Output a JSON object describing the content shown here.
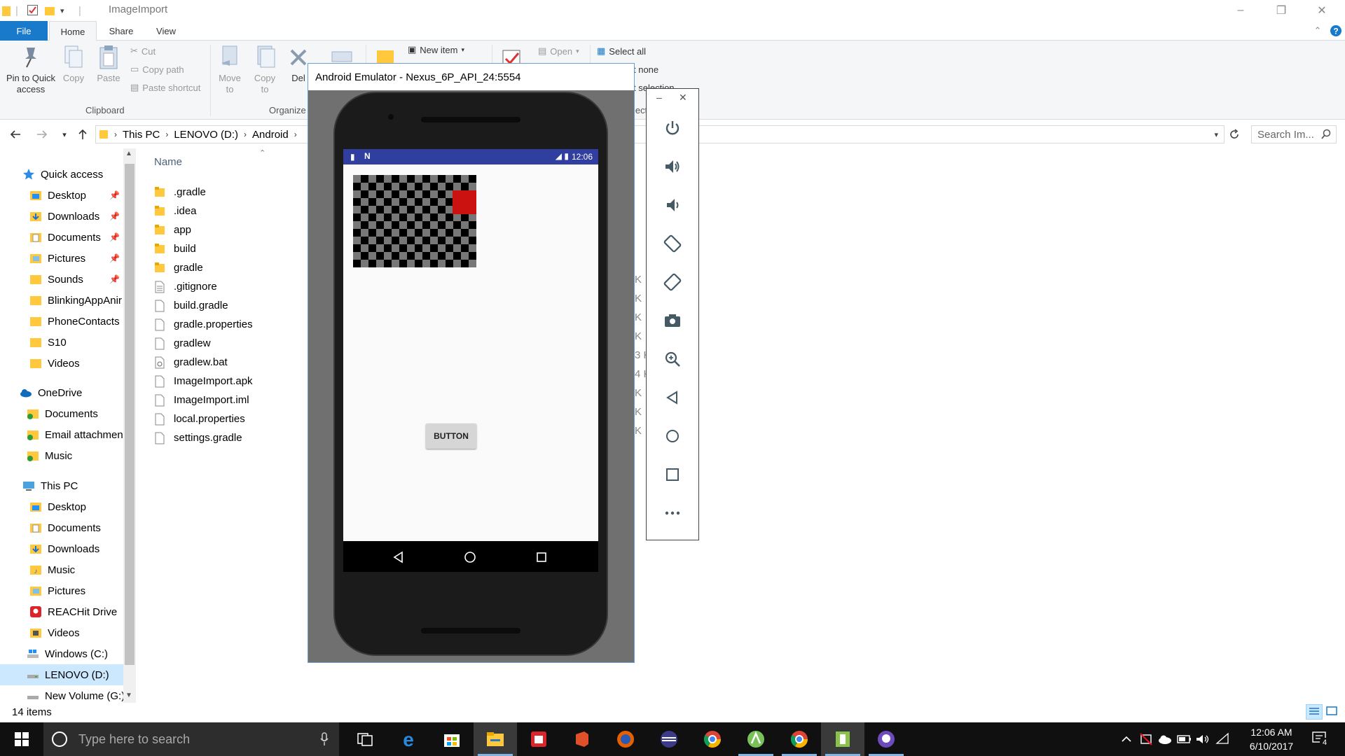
{
  "window": {
    "title": "ImageImport",
    "controls": {
      "minimize": "–",
      "restore": "❐",
      "close": "✕"
    }
  },
  "ribbon": {
    "tabs": [
      "File",
      "Home",
      "Share",
      "View"
    ],
    "active_tab": "Home",
    "clipboard": {
      "pin_label_1": "Pin to Quick",
      "pin_label_2": "access",
      "copy": "Copy",
      "paste": "Paste",
      "cut": "Cut",
      "copy_path": "Copy path",
      "paste_shortcut": "Paste shortcut",
      "group": "Clipboard"
    },
    "organize": {
      "move_to_1": "Move",
      "move_to_2": "to",
      "copy_to_1": "Copy",
      "copy_to_2": "to",
      "delete": "Del",
      "group": "Organize"
    },
    "new": {
      "new_item": "New item"
    },
    "open": {
      "open": "Open"
    },
    "select": {
      "select_all": "Select all",
      "select_none": "t none",
      "invert": "t selection",
      "group_partial": "lect"
    }
  },
  "address": {
    "breadcrumbs": [
      "This PC",
      "LENOVO (D:)",
      "Android"
    ],
    "search_placeholder": "Search Im..."
  },
  "nav": {
    "quick_access": "Quick access",
    "quick_items": [
      "Desktop",
      "Downloads",
      "Documents",
      "Pictures",
      "Sounds",
      "BlinkingAppAnir",
      "PhoneContacts",
      "S10",
      "Videos"
    ],
    "onedrive": "OneDrive",
    "onedrive_items": [
      "Documents",
      "Email attachmen",
      "Music"
    ],
    "this_pc": "This PC",
    "pc_items": [
      "Desktop",
      "Documents",
      "Downloads",
      "Music",
      "Pictures",
      "REACHit Drive",
      "Videos",
      "Windows (C:)",
      "LENOVO (D:)",
      "New Volume (G:)"
    ],
    "selected": "LENOVO (D:)"
  },
  "files": {
    "column_name": "Name",
    "items": [
      ".gradle",
      ".idea",
      "app",
      "build",
      "gradle",
      ".gitignore",
      "build.gradle",
      "gradle.properties",
      "gradlew",
      "gradlew.bat",
      "ImageImport.apk",
      "ImageImport.iml",
      "local.properties",
      "settings.gradle"
    ],
    "folder_count": 5,
    "size_fragments": [
      "K",
      "K",
      "K",
      "K",
      "3 K",
      "4 K",
      "K",
      "K",
      "K"
    ]
  },
  "status": {
    "items_count": "14 items"
  },
  "emulator": {
    "title": "Android Emulator - Nexus_6P_API_24:5554",
    "android_time": "12:06",
    "button_label": "BUTTON",
    "tools": [
      "power-icon",
      "volume-up-icon",
      "volume-down-icon",
      "rotate-left-icon",
      "rotate-right-icon",
      "camera-icon",
      "zoom-icon",
      "back-icon",
      "home-icon",
      "overview-icon",
      "more-icon"
    ],
    "tools_window": {
      "minimize": "–",
      "close": "✕"
    }
  },
  "taskbar": {
    "search_placeholder": "Type here to search",
    "clock_time": "12:06 AM",
    "clock_date": "6/10/2017",
    "notifications_count": "4",
    "apps": [
      "task-view-icon",
      "edge-icon",
      "store-icon",
      "file-explorer-icon",
      "reader-icon",
      "office-icon",
      "firefox-icon",
      "media-icon",
      "chrome-icon",
      "android-studio-icon",
      "chrome-icon",
      "files-icon",
      "github-icon"
    ]
  },
  "colors": {
    "accent": "#1979ca",
    "android_statusbar": "#303f9f",
    "selected_bg": "#cce8ff",
    "folder": "#ffc83d"
  }
}
